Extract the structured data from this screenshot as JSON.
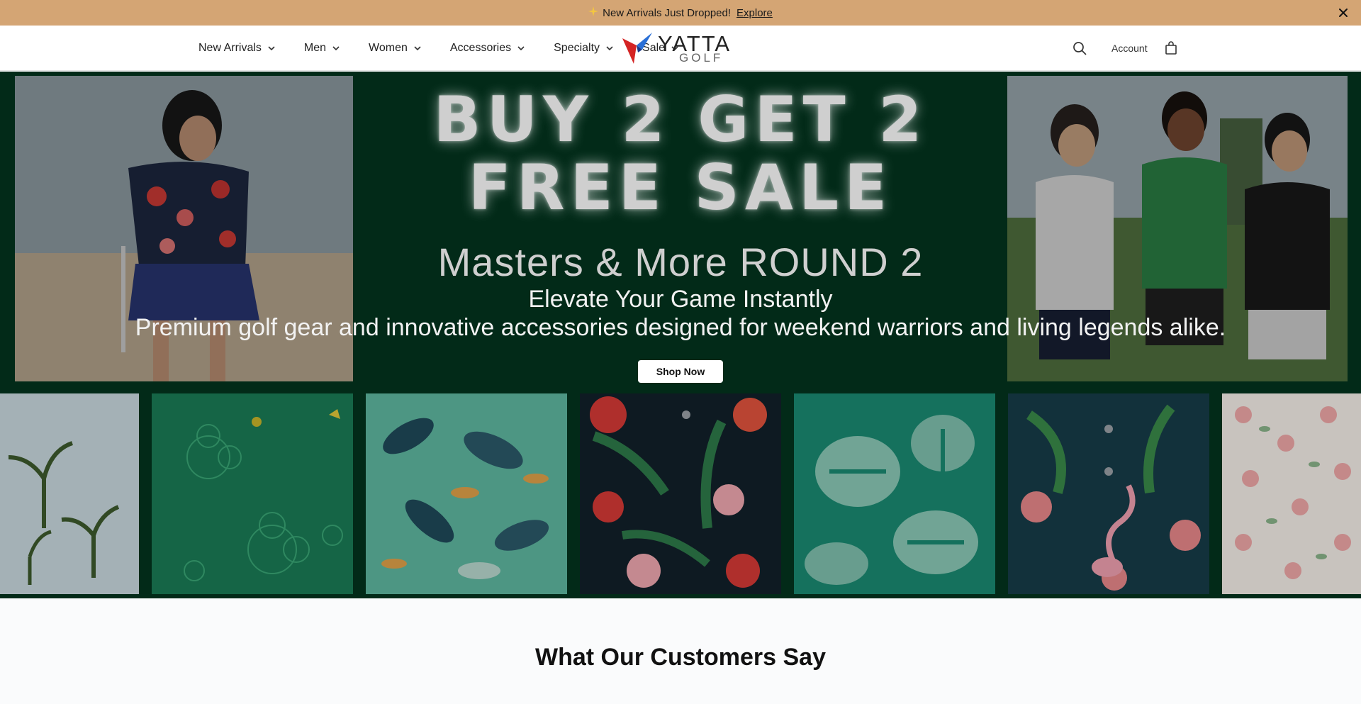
{
  "announcement": {
    "icon": "sparkle-icon",
    "text": "New Arrivals Just Dropped!",
    "link": "Explore",
    "bg_color": "#d4a574"
  },
  "header": {
    "nav": [
      {
        "label": "New Arrivals",
        "name": "new-arrivals"
      },
      {
        "label": "Men",
        "name": "men"
      },
      {
        "label": "Women",
        "name": "women"
      },
      {
        "label": "Accessories",
        "name": "accessories"
      },
      {
        "label": "Specialty",
        "name": "specialty"
      },
      {
        "label": "Sale",
        "name": "sale"
      }
    ],
    "logo": {
      "word": "YATTA",
      "sub": "GOLF"
    },
    "account_label": "Account"
  },
  "hero": {
    "promo_line1": "BUY 2 GET 2",
    "promo_line2": "FREE SALE",
    "subhead": "Masters & More ROUND 2",
    "tagline": "Elevate Your Game Instantly",
    "description": "Premium golf gear and innovative accessories designed for weekend warriors and living legends alike.",
    "cta": "Shop Now",
    "bg_color": "#022a18"
  },
  "reviews": {
    "title": "What Our Customers Say"
  }
}
